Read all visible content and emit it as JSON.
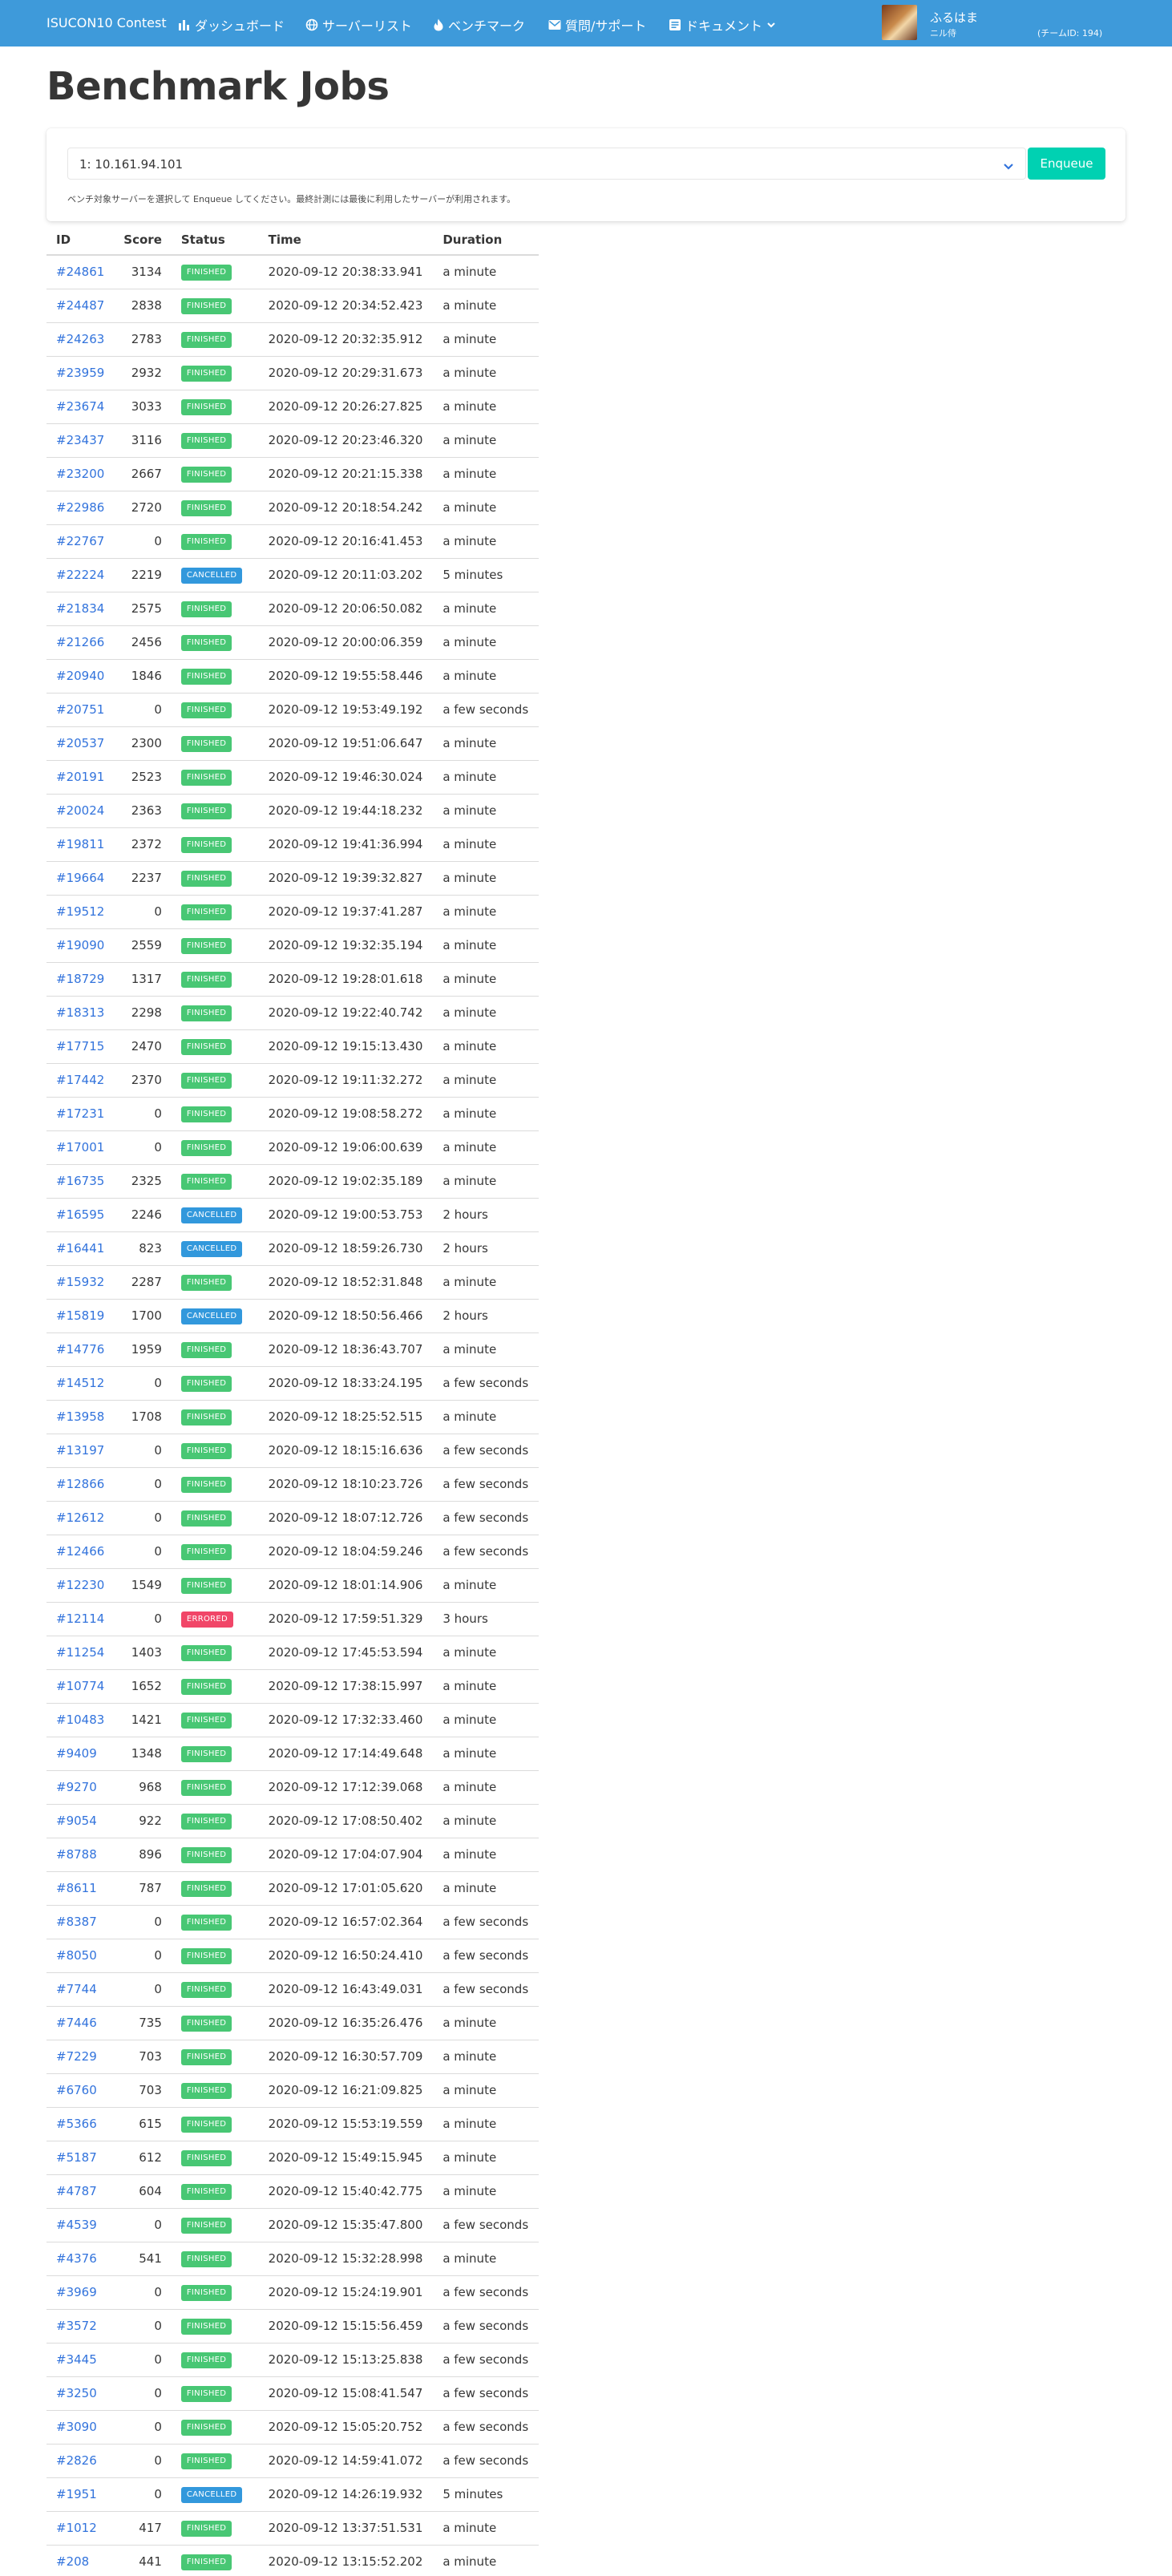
{
  "nav": {
    "brand": "ISUCON10 Contest",
    "items": [
      {
        "label": "ダッシュボード",
        "icon": "chart-bar-icon"
      },
      {
        "label": "サーバーリスト",
        "icon": "server-globe-icon"
      },
      {
        "label": "ベンチマーク",
        "icon": "fire-icon"
      },
      {
        "label": "質問/サポート",
        "icon": "support-envelope-icon"
      },
      {
        "label": "ドキュメント",
        "icon": "document-icon"
      }
    ],
    "user_name": "ふるはま",
    "user_role": "ニル侍",
    "team_id": "(チームID: 194)",
    "accent": "#3e9ada"
  },
  "page_title": "Benchmark Jobs",
  "enqueue": {
    "selected_server": "1: 10.161.94.101",
    "button_label": "Enqueue",
    "help": "ベンチ対象サーバーを選択して Enqueue してください。最終計測には最後に利用したサーバーが利用されます。",
    "button_color": "#00d1b2"
  },
  "table": {
    "headers": {
      "id": "ID",
      "score": "Score",
      "status": "Status",
      "time": "Time",
      "duration": "Duration"
    },
    "status_colors": {
      "FINISHED": "#48c774",
      "CANCELLED": "#3298dc",
      "ERRORED": "#f14668"
    },
    "rows": [
      {
        "id": "#24861",
        "score": "3134",
        "status": "FINISHED",
        "time": "2020-09-12 20:38:33.941",
        "duration": "a minute"
      },
      {
        "id": "#24487",
        "score": "2838",
        "status": "FINISHED",
        "time": "2020-09-12 20:34:52.423",
        "duration": "a minute"
      },
      {
        "id": "#24263",
        "score": "2783",
        "status": "FINISHED",
        "time": "2020-09-12 20:32:35.912",
        "duration": "a minute"
      },
      {
        "id": "#23959",
        "score": "2932",
        "status": "FINISHED",
        "time": "2020-09-12 20:29:31.673",
        "duration": "a minute"
      },
      {
        "id": "#23674",
        "score": "3033",
        "status": "FINISHED",
        "time": "2020-09-12 20:26:27.825",
        "duration": "a minute"
      },
      {
        "id": "#23437",
        "score": "3116",
        "status": "FINISHED",
        "time": "2020-09-12 20:23:46.320",
        "duration": "a minute"
      },
      {
        "id": "#23200",
        "score": "2667",
        "status": "FINISHED",
        "time": "2020-09-12 20:21:15.338",
        "duration": "a minute"
      },
      {
        "id": "#22986",
        "score": "2720",
        "status": "FINISHED",
        "time": "2020-09-12 20:18:54.242",
        "duration": "a minute"
      },
      {
        "id": "#22767",
        "score": "0",
        "status": "FINISHED",
        "time": "2020-09-12 20:16:41.453",
        "duration": "a minute"
      },
      {
        "id": "#22224",
        "score": "2219",
        "status": "CANCELLED",
        "time": "2020-09-12 20:11:03.202",
        "duration": "5 minutes"
      },
      {
        "id": "#21834",
        "score": "2575",
        "status": "FINISHED",
        "time": "2020-09-12 20:06:50.082",
        "duration": "a minute"
      },
      {
        "id": "#21266",
        "score": "2456",
        "status": "FINISHED",
        "time": "2020-09-12 20:00:06.359",
        "duration": "a minute"
      },
      {
        "id": "#20940",
        "score": "1846",
        "status": "FINISHED",
        "time": "2020-09-12 19:55:58.446",
        "duration": "a minute"
      },
      {
        "id": "#20751",
        "score": "0",
        "status": "FINISHED",
        "time": "2020-09-12 19:53:49.192",
        "duration": "a few seconds"
      },
      {
        "id": "#20537",
        "score": "2300",
        "status": "FINISHED",
        "time": "2020-09-12 19:51:06.647",
        "duration": "a minute"
      },
      {
        "id": "#20191",
        "score": "2523",
        "status": "FINISHED",
        "time": "2020-09-12 19:46:30.024",
        "duration": "a minute"
      },
      {
        "id": "#20024",
        "score": "2363",
        "status": "FINISHED",
        "time": "2020-09-12 19:44:18.232",
        "duration": "a minute"
      },
      {
        "id": "#19811",
        "score": "2372",
        "status": "FINISHED",
        "time": "2020-09-12 19:41:36.994",
        "duration": "a minute"
      },
      {
        "id": "#19664",
        "score": "2237",
        "status": "FINISHED",
        "time": "2020-09-12 19:39:32.827",
        "duration": "a minute"
      },
      {
        "id": "#19512",
        "score": "0",
        "status": "FINISHED",
        "time": "2020-09-12 19:37:41.287",
        "duration": "a minute"
      },
      {
        "id": "#19090",
        "score": "2559",
        "status": "FINISHED",
        "time": "2020-09-12 19:32:35.194",
        "duration": "a minute"
      },
      {
        "id": "#18729",
        "score": "1317",
        "status": "FINISHED",
        "time": "2020-09-12 19:28:01.618",
        "duration": "a minute"
      },
      {
        "id": "#18313",
        "score": "2298",
        "status": "FINISHED",
        "time": "2020-09-12 19:22:40.742",
        "duration": "a minute"
      },
      {
        "id": "#17715",
        "score": "2470",
        "status": "FINISHED",
        "time": "2020-09-12 19:15:13.430",
        "duration": "a minute"
      },
      {
        "id": "#17442",
        "score": "2370",
        "status": "FINISHED",
        "time": "2020-09-12 19:11:32.272",
        "duration": "a minute"
      },
      {
        "id": "#17231",
        "score": "0",
        "status": "FINISHED",
        "time": "2020-09-12 19:08:58.272",
        "duration": "a minute"
      },
      {
        "id": "#17001",
        "score": "0",
        "status": "FINISHED",
        "time": "2020-09-12 19:06:00.639",
        "duration": "a minute"
      },
      {
        "id": "#16735",
        "score": "2325",
        "status": "FINISHED",
        "time": "2020-09-12 19:02:35.189",
        "duration": "a minute"
      },
      {
        "id": "#16595",
        "score": "2246",
        "status": "CANCELLED",
        "time": "2020-09-12 19:00:53.753",
        "duration": "2 hours"
      },
      {
        "id": "#16441",
        "score": "823",
        "status": "CANCELLED",
        "time": "2020-09-12 18:59:26.730",
        "duration": "2 hours"
      },
      {
        "id": "#15932",
        "score": "2287",
        "status": "FINISHED",
        "time": "2020-09-12 18:52:31.848",
        "duration": "a minute"
      },
      {
        "id": "#15819",
        "score": "1700",
        "status": "CANCELLED",
        "time": "2020-09-12 18:50:56.466",
        "duration": "2 hours"
      },
      {
        "id": "#14776",
        "score": "1959",
        "status": "FINISHED",
        "time": "2020-09-12 18:36:43.707",
        "duration": "a minute"
      },
      {
        "id": "#14512",
        "score": "0",
        "status": "FINISHED",
        "time": "2020-09-12 18:33:24.195",
        "duration": "a few seconds"
      },
      {
        "id": "#13958",
        "score": "1708",
        "status": "FINISHED",
        "time": "2020-09-12 18:25:52.515",
        "duration": "a minute"
      },
      {
        "id": "#13197",
        "score": "0",
        "status": "FINISHED",
        "time": "2020-09-12 18:15:16.636",
        "duration": "a few seconds"
      },
      {
        "id": "#12866",
        "score": "0",
        "status": "FINISHED",
        "time": "2020-09-12 18:10:23.726",
        "duration": "a few seconds"
      },
      {
        "id": "#12612",
        "score": "0",
        "status": "FINISHED",
        "time": "2020-09-12 18:07:12.726",
        "duration": "a few seconds"
      },
      {
        "id": "#12466",
        "score": "0",
        "status": "FINISHED",
        "time": "2020-09-12 18:04:59.246",
        "duration": "a few seconds"
      },
      {
        "id": "#12230",
        "score": "1549",
        "status": "FINISHED",
        "time": "2020-09-12 18:01:14.906",
        "duration": "a minute"
      },
      {
        "id": "#12114",
        "score": "0",
        "status": "ERRORED",
        "time": "2020-09-12 17:59:51.329",
        "duration": "3 hours"
      },
      {
        "id": "#11254",
        "score": "1403",
        "status": "FINISHED",
        "time": "2020-09-12 17:45:53.594",
        "duration": "a minute"
      },
      {
        "id": "#10774",
        "score": "1652",
        "status": "FINISHED",
        "time": "2020-09-12 17:38:15.997",
        "duration": "a minute"
      },
      {
        "id": "#10483",
        "score": "1421",
        "status": "FINISHED",
        "time": "2020-09-12 17:32:33.460",
        "duration": "a minute"
      },
      {
        "id": "#9409",
        "score": "1348",
        "status": "FINISHED",
        "time": "2020-09-12 17:14:49.648",
        "duration": "a minute"
      },
      {
        "id": "#9270",
        "score": "968",
        "status": "FINISHED",
        "time": "2020-09-12 17:12:39.068",
        "duration": "a minute"
      },
      {
        "id": "#9054",
        "score": "922",
        "status": "FINISHED",
        "time": "2020-09-12 17:08:50.402",
        "duration": "a minute"
      },
      {
        "id": "#8788",
        "score": "896",
        "status": "FINISHED",
        "time": "2020-09-12 17:04:07.904",
        "duration": "a minute"
      },
      {
        "id": "#8611",
        "score": "787",
        "status": "FINISHED",
        "time": "2020-09-12 17:01:05.620",
        "duration": "a minute"
      },
      {
        "id": "#8387",
        "score": "0",
        "status": "FINISHED",
        "time": "2020-09-12 16:57:02.364",
        "duration": "a few seconds"
      },
      {
        "id": "#8050",
        "score": "0",
        "status": "FINISHED",
        "time": "2020-09-12 16:50:24.410",
        "duration": "a few seconds"
      },
      {
        "id": "#7744",
        "score": "0",
        "status": "FINISHED",
        "time": "2020-09-12 16:43:49.031",
        "duration": "a few seconds"
      },
      {
        "id": "#7446",
        "score": "735",
        "status": "FINISHED",
        "time": "2020-09-12 16:35:26.476",
        "duration": "a minute"
      },
      {
        "id": "#7229",
        "score": "703",
        "status": "FINISHED",
        "time": "2020-09-12 16:30:57.709",
        "duration": "a minute"
      },
      {
        "id": "#6760",
        "score": "703",
        "status": "FINISHED",
        "time": "2020-09-12 16:21:09.825",
        "duration": "a minute"
      },
      {
        "id": "#5366",
        "score": "615",
        "status": "FINISHED",
        "time": "2020-09-12 15:53:19.559",
        "duration": "a minute"
      },
      {
        "id": "#5187",
        "score": "612",
        "status": "FINISHED",
        "time": "2020-09-12 15:49:15.945",
        "duration": "a minute"
      },
      {
        "id": "#4787",
        "score": "604",
        "status": "FINISHED",
        "time": "2020-09-12 15:40:42.775",
        "duration": "a minute"
      },
      {
        "id": "#4539",
        "score": "0",
        "status": "FINISHED",
        "time": "2020-09-12 15:35:47.800",
        "duration": "a few seconds"
      },
      {
        "id": "#4376",
        "score": "541",
        "status": "FINISHED",
        "time": "2020-09-12 15:32:28.998",
        "duration": "a minute"
      },
      {
        "id": "#3969",
        "score": "0",
        "status": "FINISHED",
        "time": "2020-09-12 15:24:19.901",
        "duration": "a few seconds"
      },
      {
        "id": "#3572",
        "score": "0",
        "status": "FINISHED",
        "time": "2020-09-12 15:15:56.459",
        "duration": "a few seconds"
      },
      {
        "id": "#3445",
        "score": "0",
        "status": "FINISHED",
        "time": "2020-09-12 15:13:25.838",
        "duration": "a few seconds"
      },
      {
        "id": "#3250",
        "score": "0",
        "status": "FINISHED",
        "time": "2020-09-12 15:08:41.547",
        "duration": "a few seconds"
      },
      {
        "id": "#3090",
        "score": "0",
        "status": "FINISHED",
        "time": "2020-09-12 15:05:20.752",
        "duration": "a few seconds"
      },
      {
        "id": "#2826",
        "score": "0",
        "status": "FINISHED",
        "time": "2020-09-12 14:59:41.072",
        "duration": "a few seconds"
      },
      {
        "id": "#1951",
        "score": "0",
        "status": "CANCELLED",
        "time": "2020-09-12 14:26:19.932",
        "duration": "5 minutes"
      },
      {
        "id": "#1012",
        "score": "417",
        "status": "FINISHED",
        "time": "2020-09-12 13:37:51.531",
        "duration": "a minute"
      },
      {
        "id": "#208",
        "score": "441",
        "status": "FINISHED",
        "time": "2020-09-12 13:15:52.202",
        "duration": "a minute"
      }
    ]
  }
}
